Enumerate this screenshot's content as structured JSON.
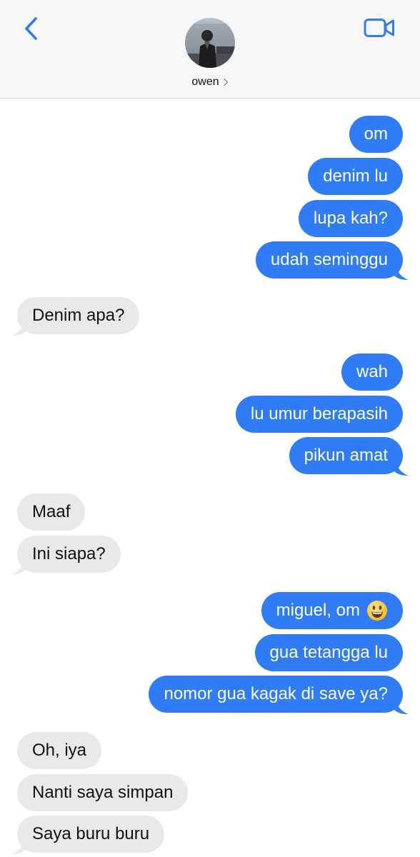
{
  "header": {
    "contact_name": "owen",
    "chevron": ">",
    "icons": {
      "back": "chevron-left-icon",
      "video": "video-camera-icon",
      "avatar": "contact-avatar-photo"
    },
    "accent_color": "#2f7cf6"
  },
  "colors": {
    "sent_bubble": "#2f7cf6",
    "received_bubble": "#e9e9eb",
    "header_bg": "#f7f7f7"
  },
  "messages": [
    {
      "from": "me",
      "text": "om"
    },
    {
      "from": "me",
      "text": "denim lu"
    },
    {
      "from": "me",
      "text": "lupa kah?"
    },
    {
      "from": "me",
      "text": "udah seminggu"
    },
    {
      "from": "them",
      "text": "Denim apa?"
    },
    {
      "from": "me",
      "text": "wah"
    },
    {
      "from": "me",
      "text": "lu umur berapasih"
    },
    {
      "from": "me",
      "text": "pikun amat"
    },
    {
      "from": "them",
      "text": "Maaf"
    },
    {
      "from": "them",
      "text": "Ini siapa?"
    },
    {
      "from": "me",
      "text": "miguel, om"
    },
    {
      "from": "me",
      "text": "gua tetangga lu"
    },
    {
      "from": "me",
      "text": "nomor gua kagak di save ya?"
    },
    {
      "from": "them",
      "text": "Oh, iya"
    },
    {
      "from": "them",
      "text": "Nanti saya simpan"
    },
    {
      "from": "them",
      "text": "Saya buru buru"
    }
  ]
}
